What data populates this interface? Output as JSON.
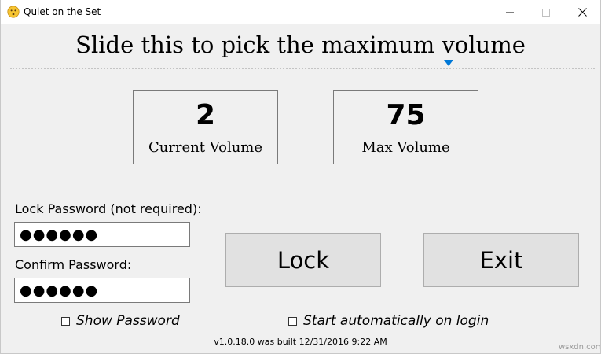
{
  "window": {
    "title": "Quiet on the Set",
    "icon": "smiley-face-icon",
    "controls": {
      "minimize": "minimize-icon",
      "maximize": "maximize-icon",
      "close": "close-icon"
    }
  },
  "headline": "Slide this to pick the maximum volume",
  "slider": {
    "value_fraction": 0.75
  },
  "current_volume": {
    "value": "2",
    "label": "Current Volume"
  },
  "max_volume": {
    "value": "75",
    "label": "Max Volume"
  },
  "lock_password": {
    "label": "Lock Password (not required):",
    "value": "●●●●●●"
  },
  "confirm_password": {
    "label": "Confirm Password:",
    "value": "●●●●●●"
  },
  "buttons": {
    "lock": "Lock",
    "exit": "Exit"
  },
  "options": {
    "show_password": "Show Password",
    "start_automatically": "Start automatically on login"
  },
  "build_info": "v1.0.18.0 was built 12/31/2016 9:22 AM",
  "watermark": "wsxdn.com",
  "colors": {
    "accent": "#0078d7",
    "window_bg": "#f0f0f0",
    "button_bg": "#e1e1e1"
  }
}
